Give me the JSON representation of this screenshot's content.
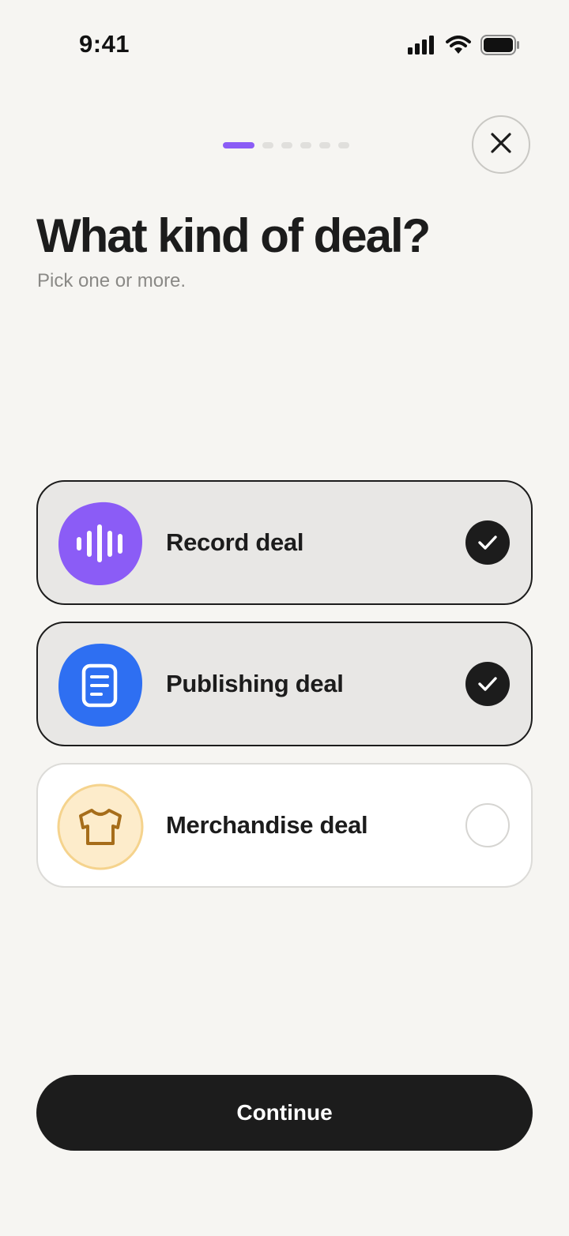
{
  "status_bar": {
    "time": "9:41",
    "icons": [
      "cellular-signal-icon",
      "wifi-icon",
      "battery-icon"
    ]
  },
  "progress": {
    "total_steps": 6,
    "current_step": 1,
    "accent_color": "#8b5cf6"
  },
  "header": {
    "title": "What kind of deal?",
    "subtitle": "Pick one or more."
  },
  "options": [
    {
      "label": "Record deal",
      "icon": "audio-waveform-icon",
      "icon_color": "#8b5cf6",
      "selected": true
    },
    {
      "label": "Publishing deal",
      "icon": "document-icon",
      "icon_color": "#2e6ff2",
      "selected": true
    },
    {
      "label": "Merchandise deal",
      "icon": "t-shirt-icon",
      "icon_color": "#fdeccb",
      "selected": false
    }
  ],
  "footer": {
    "continue_label": "Continue"
  }
}
